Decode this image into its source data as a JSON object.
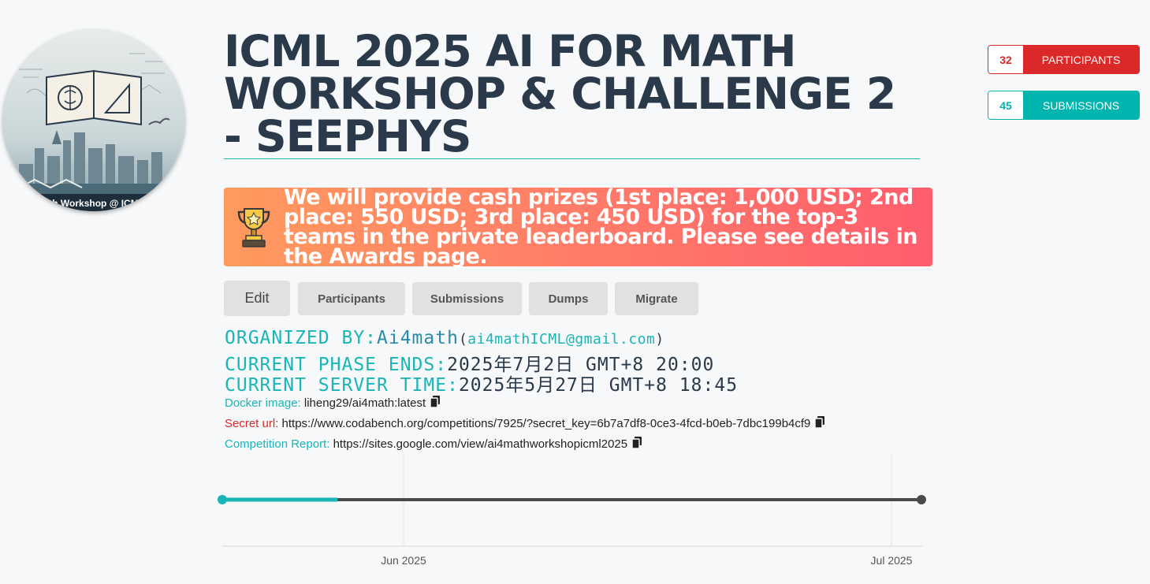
{
  "logo": {
    "caption": "th Workshop @ ICM",
    "icon": "workshop-logo"
  },
  "title": "ICML 2025 AI FOR MATH WORKSHOP & CHALLENGE 2 - SEEPHYS",
  "stats": {
    "participants": {
      "count": "32",
      "label": "PARTICIPANTS",
      "color": "#db2828"
    },
    "submissions": {
      "count": "45",
      "label": "SUBMISSIONS",
      "color": "#00b5ad"
    }
  },
  "banner": {
    "icon": "trophy-icon",
    "text": "We will provide cash prizes (1st place: 1,000 USD; 2nd place: 550 USD; 3rd place: 450 USD) for the top-3 teams in the private leaderboard. Please see details in the Awards page."
  },
  "buttons": {
    "edit": "Edit",
    "participants": "Participants",
    "submissions": "Submissions",
    "dumps": "Dumps",
    "migrate": "Migrate"
  },
  "info": {
    "organized_label": "ORGANIZED BY:",
    "organizer": "Ai4math",
    "email": "ai4mathICML@gmail.com",
    "phase_label": "CURRENT PHASE ENDS:",
    "phase_value": "2025年7月2日 GMT+8 20:00",
    "server_label": "CURRENT SERVER TIME:",
    "server_value": "2025年5月27日 GMT+8 18:45",
    "docker_label": "Docker image:",
    "docker_value": "liheng29/ai4math:latest",
    "secret_label": "Secret url:",
    "secret_value": "https://www.codabench.org/competitions/7925/?secret_key=6b7a7df8-0ce3-4fcd-b0eb-7dbc199b4cf9",
    "report_label": "Competition Report:",
    "report_value": "https://sites.google.com/view/ai4mathworkshopicml2025"
  },
  "timeline": {
    "ticks": [
      "Jun 2025",
      "Jul 2025"
    ],
    "progress_fraction": 0.165,
    "colors": {
      "done": "#1ab5b7",
      "remaining": "#4a4a4a"
    }
  }
}
